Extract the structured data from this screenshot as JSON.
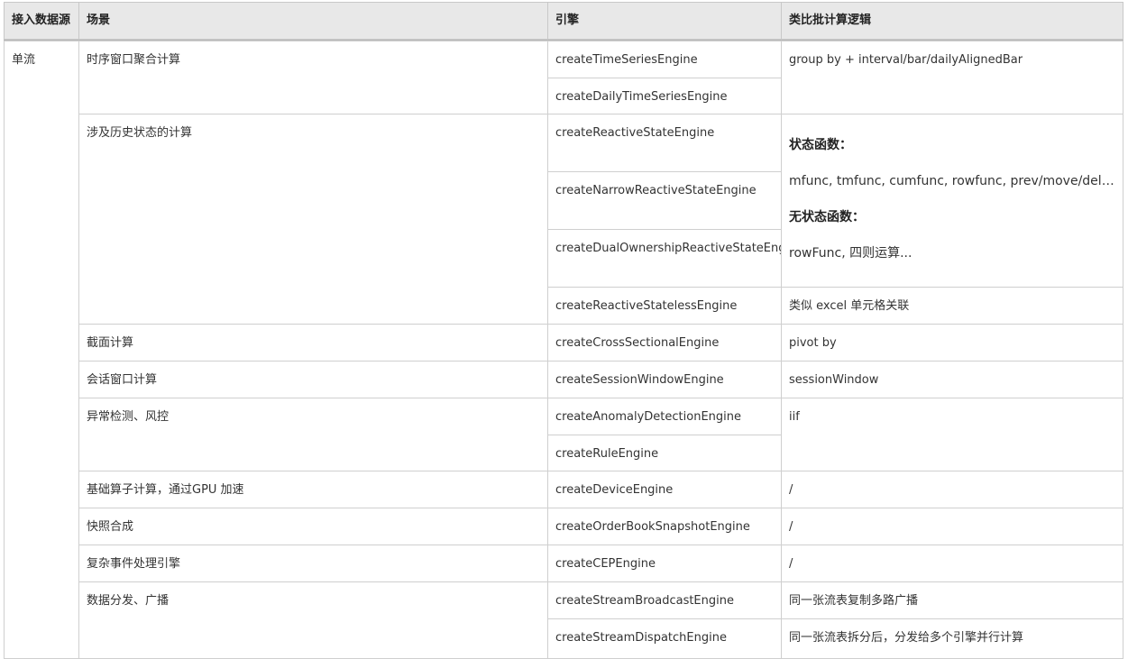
{
  "headers": [
    "接入数据源",
    "场景",
    "引擎",
    "类比批计算逻辑"
  ],
  "source": "单流",
  "scenarios": [
    "时序窗口聚合计算",
    "涉及历史状态的计算",
    "截面计算",
    "会话窗口计算",
    "异常检测、风控",
    "基础算子计算，通过GPU 加速",
    "快照合成",
    "复杂事件处理引擎",
    "数据分发、广播"
  ],
  "engines": [
    "createTimeSeriesEngine",
    "createDailyTimeSeriesEngine",
    "createReactiveStateEngine",
    "createNarrowReactiveStateEngine",
    "createDualOwnershipReactiveStateEngine",
    "createReactiveStatelessEngine",
    "createCrossSectionalEngine",
    "createSessionWindowEngine",
    "createAnomalyDetectionEngine",
    "createRuleEngine",
    "createDeviceEngine",
    "createOrderBookSnapshotEngine",
    "createCEPEngine",
    "createStreamBroadcastEngine",
    "createStreamDispatchEngine"
  ],
  "logic": {
    "time_series": "group by + interval/bar/dailyAlignedBar",
    "stateful_heading": "状态函数：",
    "stateful_text": "mfunc, tmfunc, cumfunc, rowfunc, prev/move/deltas...",
    "stateless_heading": "无状态函数：",
    "stateless_text": "rowFunc, 四则运算...",
    "stateless_engine": "类似 excel 单元格关联",
    "cross_sectional": "pivot by",
    "session_window": "sessionWindow",
    "anomaly": "iif",
    "device": "/",
    "snapshot": "/",
    "cep": "/",
    "broadcast": "同一张流表复制多路广播",
    "dispatch": "同一张流表拆分后，分发给多个引擎并行计算"
  }
}
